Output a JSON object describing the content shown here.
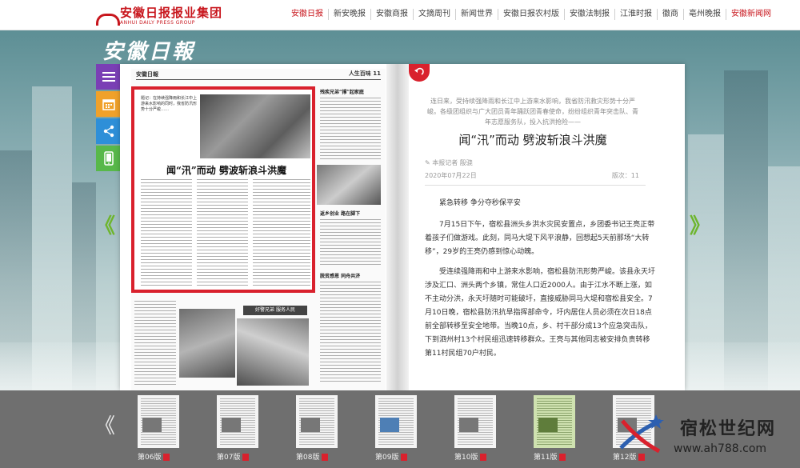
{
  "header": {
    "brand": "安徽日报报业集团",
    "brand_sub": "ANHUI DAILY PRESS GROUP",
    "nav": [
      {
        "label": "安徽日报",
        "state": "active"
      },
      {
        "label": "新安晚报",
        "state": ""
      },
      {
        "label": "安徽商报",
        "state": ""
      },
      {
        "label": "文摘周刊",
        "state": ""
      },
      {
        "label": "新闻世界",
        "state": ""
      },
      {
        "label": "安徽日报农村版",
        "state": ""
      },
      {
        "label": "安徽法制报",
        "state": ""
      },
      {
        "label": "江淮时报",
        "state": ""
      },
      {
        "label": "徽商",
        "state": ""
      },
      {
        "label": "亳州晚报",
        "state": ""
      },
      {
        "label": "安徽新闻网",
        "state": "red"
      }
    ]
  },
  "masthead": "安徽日報",
  "toolbar": {
    "menu_icon": "menu-icon",
    "calendar_icon": "calendar-icon",
    "share_icon": "share-icon",
    "phone_icon": "phone-icon"
  },
  "nav_arrows": {
    "prev": "《",
    "next": "》"
  },
  "newspaper": {
    "head_left": "安徽日報",
    "head_right": "人生百味 11",
    "headline": "闻“汛”而动 劈波斩浪斗洪魔",
    "intro": "题记：在持续强降雨和长江中上游来水影响的同时，我省防汛形势十分严峻……",
    "side_title_1": "残疾兄弟“撑”起家庭",
    "side_title_2": "返乡创业 路在脚下",
    "side_title_3": "脱贫感恩 同舟共济",
    "box_title": "好警兄弟 服务人民"
  },
  "article": {
    "back_icon": "return-icon",
    "lead": "连日来，受持续强降雨和长江中上游来水影响，我省防汛救灾形势十分严峻。各级团组织与广大团员青年踊跃团青春使命，纷纷组织青年突击队、青年志愿服务队，投入抗洪抢险——",
    "title": "闻“汛”而动 劈波斩浪斗洪魔",
    "reporter": "本报记者 殷骁",
    "date": "2020年07月22日",
    "page_label": "版次：11",
    "subhead": "紧急转移 争分夺秒保平安",
    "p1": "7月15日下午，宿松县洲头乡洪水灾民安置点，乡团委书记王亮正带着孩子们做游戏。此刻，同马大堤下风平浪静，回想起5天前那场“大转移”，29岁的王亮仍感到惊心动魄。",
    "p2": "受连续强降雨和中上游来水影响，宿松县防汛形势严峻。该县永天圩涉及汇口、洲头两个乡镇，常住人口近2000人。由于江水不断上涨，如不主动分洪，永天圩随时可能破圩，直接威胁同马大堤和宿松县安全。7月10日晚，宿松县防汛抗旱指挥部命令，圩内居住人员必须在次日18点前全部转移至安全地带。当晚10点，乡、村干部分成13个应急突击队，下到泗州村13个村民组迅速转移群众。王亮与其他同志被安排负责转移第11村民组70户村民。"
  },
  "thumbnails": [
    {
      "label": "第06版",
      "style": ""
    },
    {
      "label": "第07版",
      "style": ""
    },
    {
      "label": "第08版",
      "style": ""
    },
    {
      "label": "第09版",
      "style": "color"
    },
    {
      "label": "第10版",
      "style": ""
    },
    {
      "label": "第11版",
      "style": "green"
    },
    {
      "label": "第12版",
      "style": ""
    }
  ],
  "strip_arrow": "《",
  "watermark": {
    "name": "宿松世纪网",
    "url": "www.ah788.com"
  }
}
